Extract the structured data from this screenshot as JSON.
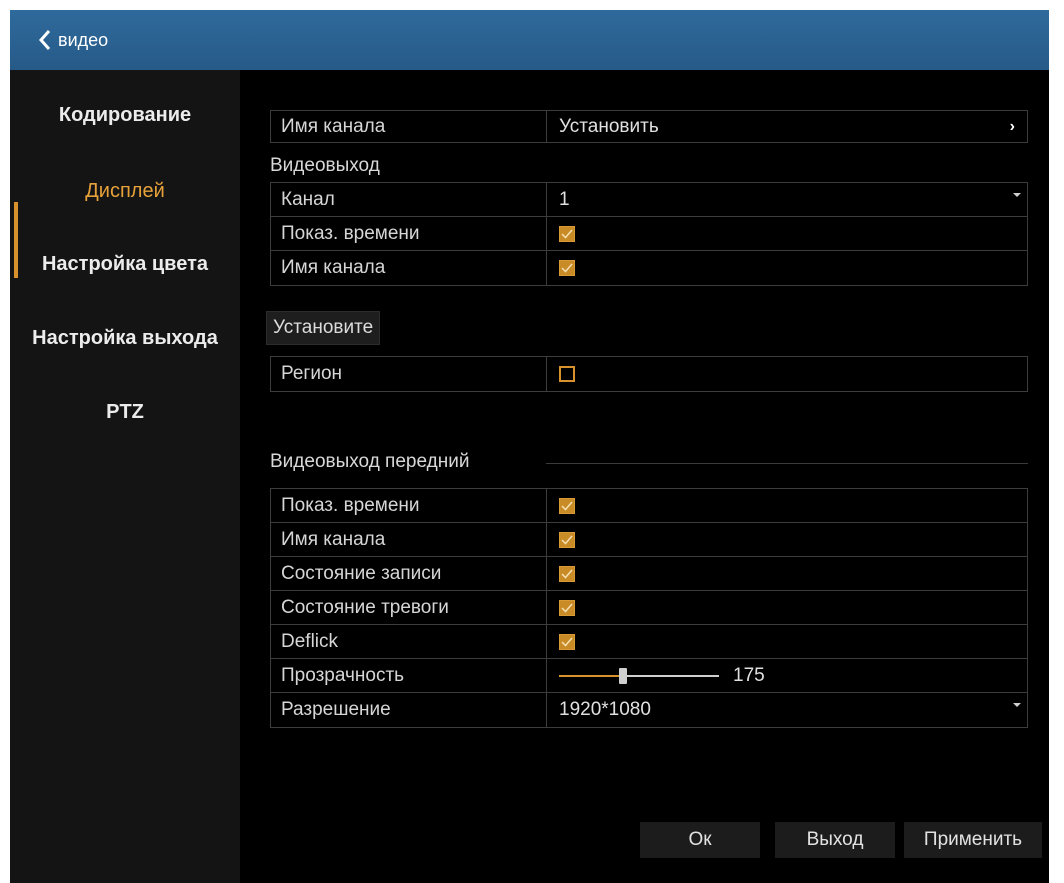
{
  "header": {
    "back_label": "видео"
  },
  "sidebar": {
    "items": [
      {
        "label": "Кодирование"
      },
      {
        "label": "Дисплей"
      },
      {
        "label": "Настройка цвета"
      },
      {
        "label": "Настройка выхода"
      },
      {
        "label": "PTZ"
      }
    ],
    "active": "Дисплей"
  },
  "channel_name_row": {
    "label": "Имя канала",
    "value": "Установить"
  },
  "video_out": {
    "title": "Видеовыход",
    "channel_label": "Канал",
    "channel_value": "1",
    "show_time_label": "Показ. времени",
    "show_time_checked": true,
    "channel_name_label": "Имя канала",
    "channel_name_checked": true
  },
  "set_button_label": "Установите",
  "region": {
    "label": "Регион",
    "checked": false
  },
  "front": {
    "title": "Видеовыход передний",
    "show_time_label": "Показ. времени",
    "channel_name_label": "Имя канала",
    "record_state_label": "Состояние записи",
    "alarm_state_label": "Состояние тревоги",
    "deflick_label": "Deflick",
    "transparency_label": "Прозрачность",
    "transparency_value": "175",
    "resolution_label": "Разрешение",
    "resolution_value": "1920*1080",
    "all_checked": true
  },
  "footer": {
    "ok_label": "Ок",
    "exit_label": "Выход",
    "apply_label": "Применить"
  },
  "colors": {
    "accent": "#d7922d",
    "titlebar": "#2b6394",
    "background": "#000000"
  }
}
